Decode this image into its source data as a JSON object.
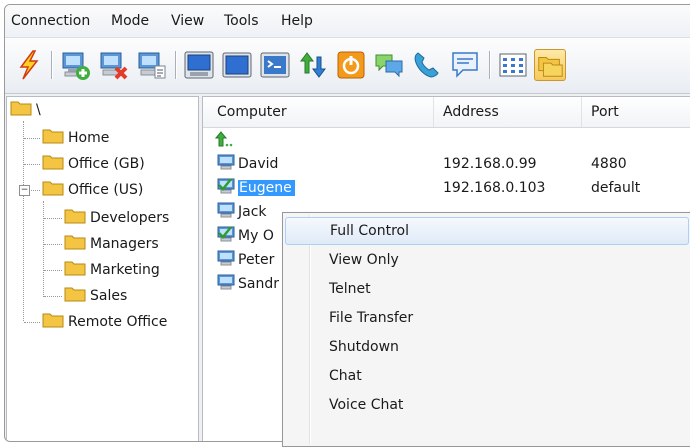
{
  "menubar": {
    "items": [
      "Connection",
      "Mode",
      "View",
      "Tools",
      "Help"
    ]
  },
  "toolbar": {
    "buttons": [
      "connect-icon",
      "add-computer-icon",
      "delete-computer-icon",
      "computer-properties-icon",
      "full-control-icon",
      "view-only-icon",
      "telnet-icon",
      "file-transfer-icon",
      "shutdown-icon",
      "chat-icon",
      "voice-chat-icon",
      "send-message-icon",
      "list-view-icon",
      "tree-view-icon"
    ],
    "active": "tree-view-icon"
  },
  "tree": {
    "root": "\\",
    "nodes": [
      {
        "label": "Home",
        "level": 1
      },
      {
        "label": "Office (GB)",
        "level": 1
      },
      {
        "label": "Office (US)",
        "level": 1,
        "expanded": true
      },
      {
        "label": "Developers",
        "level": 2
      },
      {
        "label": "Managers",
        "level": 2
      },
      {
        "label": "Marketing",
        "level": 2
      },
      {
        "label": "Sales",
        "level": 2
      },
      {
        "label": "Remote Office",
        "level": 1
      }
    ]
  },
  "list": {
    "columns": [
      "Computer",
      "Address",
      "Port"
    ],
    "rows": [
      {
        "name": "David",
        "address": "192.168.0.99",
        "port": "4880"
      },
      {
        "name": "Eugene",
        "address": "192.168.0.103",
        "port": "default",
        "selected": true
      },
      {
        "name": "Jack",
        "address": "",
        "port": ""
      },
      {
        "name": "My O",
        "address": "",
        "port": ""
      },
      {
        "name": "Peter",
        "address": "",
        "port": ""
      },
      {
        "name": "Sandr",
        "address": "",
        "port": ""
      }
    ]
  },
  "context_menu": {
    "items": [
      "Full Control",
      "View Only",
      "Telnet",
      "File Transfer",
      "Shutdown",
      "Chat",
      "Voice Chat"
    ],
    "highlighted": "Full Control"
  },
  "colors": {
    "selection": "#3399ff",
    "toolbar_active": "#f7c95b",
    "folder": "#f4c542"
  }
}
